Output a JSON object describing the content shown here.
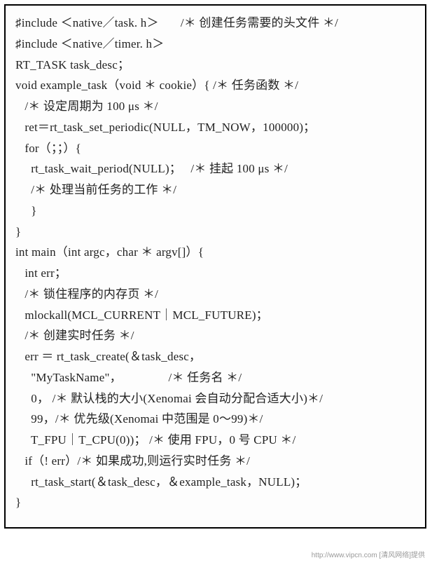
{
  "code": {
    "lines": [
      "♯include ＜native／task. h＞       /＊ 创建任务需要的头文件 ＊/",
      "♯include ＜native／timer. h＞",
      "RT_TASK task_desc；",
      "void example_task（void ＊ cookie）{ /＊ 任务函数 ＊/",
      "   /＊ 设定周期为 100 μs ＊/",
      "   ret＝rt_task_set_periodic(NULL，TM_NOW，100000)；",
      "   for（；；）{",
      "     rt_task_wait_period(NULL)；   /＊ 挂起 100 μs ＊/",
      "     /＊ 处理当前任务的工作 ＊/",
      "     }",
      "}",
      "int main（int argc，char ＊ argv[]）{",
      "   int err；",
      "   /＊ 锁住程序的内存页 ＊/",
      "   mlockall(MCL_CURRENT｜MCL_FUTURE)；",
      "   /＊ 创建实时任务 ＊/",
      "   err ＝ rt_task_create(＆task_desc，",
      "     \"MyTaskName\"，               /＊ 任务名 ＊/",
      "     0， /＊ 默认栈的大小(Xenomai 会自动分配合适大小)＊/",
      "     99，/＊ 优先级(Xenomai 中范围是 0～99)＊/",
      "     T_FPU｜T_CPU(0))； /＊ 使用 FPU，0 号 CPU ＊/",
      "   if（! err）/＊ 如果成功,则运行实时任务 ＊/",
      "     rt_task_start(＆task_desc，＆example_task，NULL)；",
      "}"
    ]
  },
  "footer": "http://www.vipcn.com [清风网络]提供"
}
